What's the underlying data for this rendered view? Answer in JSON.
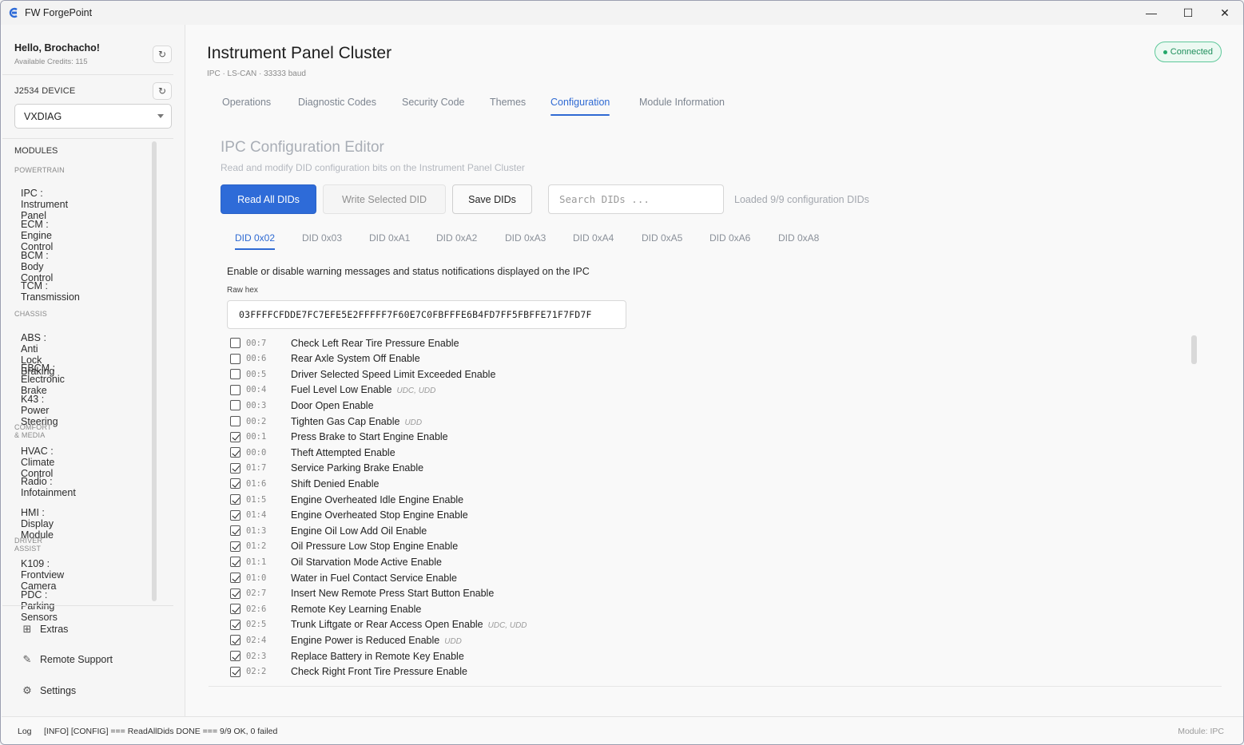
{
  "app": {
    "title": "FW ForgePoint"
  },
  "window_controls": {
    "minimize": "—",
    "maximize": "☐",
    "close": "✕"
  },
  "sidebar": {
    "greeting": "Hello, Brochacho!",
    "credits": "Available Credits: 115",
    "device_label": "J2534 DEVICE",
    "device_selected": "VXDIAG",
    "modules_label": "MODULES",
    "categories": [
      {
        "name": "POWERTRAIN",
        "items": [
          "IPC : Instrument Panel",
          "ECM : Engine Control",
          "BCM : Body Control",
          "TCM : Transmission"
        ]
      },
      {
        "name": "CHASSIS",
        "items": [
          "ABS : Anti Lock Braking",
          "EBCM : Electronic Brake",
          "K43 : Power Steering"
        ]
      },
      {
        "name": "COMFORT & MEDIA",
        "items": [
          "HVAC : Climate Control",
          "Radio : Infotainment",
          "HMI : Display Module"
        ]
      },
      {
        "name": "DRIVER ASSIST",
        "items": [
          "K109 : Frontview Camera",
          "PDC : Parking Sensors"
        ]
      }
    ],
    "footer": [
      {
        "label": "Extras",
        "icon": "extras-icon"
      },
      {
        "label": "Remote Support",
        "icon": "remote-support-icon"
      },
      {
        "label": "Settings",
        "icon": "gear-icon"
      }
    ]
  },
  "header": {
    "title": "Instrument Panel Cluster",
    "subtitle": "IPC · LS-CAN · 33333 baud",
    "status": "Connected"
  },
  "tabs": [
    "Operations",
    "Diagnostic Codes",
    "Security Code",
    "Themes",
    "Configuration",
    "Module Information"
  ],
  "active_tab": "Configuration",
  "editor": {
    "title": "IPC Configuration Editor",
    "description": "Read and modify DID configuration bits on the Instrument Panel Cluster",
    "read_all": "Read All DIDs",
    "write_selected": "Write Selected DID",
    "save": "Save DIDs",
    "search_placeholder": "Search DIDs ...",
    "loaded_text": "Loaded 9/9 configuration DIDs",
    "did_tabs": [
      "DID 0x02",
      "DID 0x03",
      "DID 0xA1",
      "DID 0xA2",
      "DID 0xA3",
      "DID 0xA4",
      "DID 0xA5",
      "DID 0xA6",
      "DID 0xA8"
    ],
    "active_did": "DID 0x02",
    "did_description": "Enable or disable warning messages and status notifications displayed on the IPC",
    "raw_hex_label": "Raw hex",
    "raw_hex": "03FFFFCFDDE7FC7EFE5E2FFFFF7F60E7C0FBFFFE6B4FD7FF5FBFFE71F7FD7F",
    "bits": [
      {
        "bit": "00:7",
        "name": "Check Left Rear Tire Pressure Enable",
        "checked": false,
        "tags": ""
      },
      {
        "bit": "00:6",
        "name": "Rear Axle System Off Enable",
        "checked": false,
        "tags": ""
      },
      {
        "bit": "00:5",
        "name": "Driver Selected Speed Limit Exceeded Enable",
        "checked": false,
        "tags": ""
      },
      {
        "bit": "00:4",
        "name": "Fuel Level Low Enable",
        "checked": false,
        "tags": "UDC, UDD"
      },
      {
        "bit": "00:3",
        "name": "Door Open Enable",
        "checked": false,
        "tags": ""
      },
      {
        "bit": "00:2",
        "name": "Tighten Gas Cap Enable",
        "checked": false,
        "tags": "UDD"
      },
      {
        "bit": "00:1",
        "name": "Press Brake to Start Engine Enable",
        "checked": true,
        "tags": ""
      },
      {
        "bit": "00:0",
        "name": "Theft Attempted Enable",
        "checked": true,
        "tags": ""
      },
      {
        "bit": "01:7",
        "name": "Service Parking Brake Enable",
        "checked": true,
        "tags": ""
      },
      {
        "bit": "01:6",
        "name": "Shift Denied Enable",
        "checked": true,
        "tags": ""
      },
      {
        "bit": "01:5",
        "name": "Engine Overheated Idle Engine Enable",
        "checked": true,
        "tags": ""
      },
      {
        "bit": "01:4",
        "name": "Engine Overheated Stop Engine Enable",
        "checked": true,
        "tags": ""
      },
      {
        "bit": "01:3",
        "name": "Engine Oil Low Add Oil Enable",
        "checked": true,
        "tags": ""
      },
      {
        "bit": "01:2",
        "name": "Oil Pressure Low Stop Engine Enable",
        "checked": true,
        "tags": ""
      },
      {
        "bit": "01:1",
        "name": "Oil Starvation Mode Active Enable",
        "checked": true,
        "tags": ""
      },
      {
        "bit": "01:0",
        "name": "Water in Fuel Contact Service Enable",
        "checked": true,
        "tags": ""
      },
      {
        "bit": "02:7",
        "name": "Insert New Remote Press Start Button Enable",
        "checked": true,
        "tags": ""
      },
      {
        "bit": "02:6",
        "name": "Remote Key Learning Enable",
        "checked": true,
        "tags": ""
      },
      {
        "bit": "02:5",
        "name": "Trunk Liftgate or Rear Access Open Enable",
        "checked": true,
        "tags": "UDC, UDD"
      },
      {
        "bit": "02:4",
        "name": "Engine Power is Reduced Enable",
        "checked": true,
        "tags": "UDD"
      },
      {
        "bit": "02:3",
        "name": "Replace Battery in Remote Key Enable",
        "checked": true,
        "tags": ""
      },
      {
        "bit": "02:2",
        "name": "Check Right Front Tire Pressure Enable",
        "checked": true,
        "tags": ""
      }
    ]
  },
  "status_bar": {
    "log_label": "Log",
    "log_text": "[INFO] [CONFIG] === ReadAllDids DONE === 9/9 OK, 0 failed",
    "module": "Module: IPC"
  },
  "colors": {
    "accent": "#2e6bd8",
    "connected": "#23a86a",
    "muted": "#8a8a8a"
  }
}
